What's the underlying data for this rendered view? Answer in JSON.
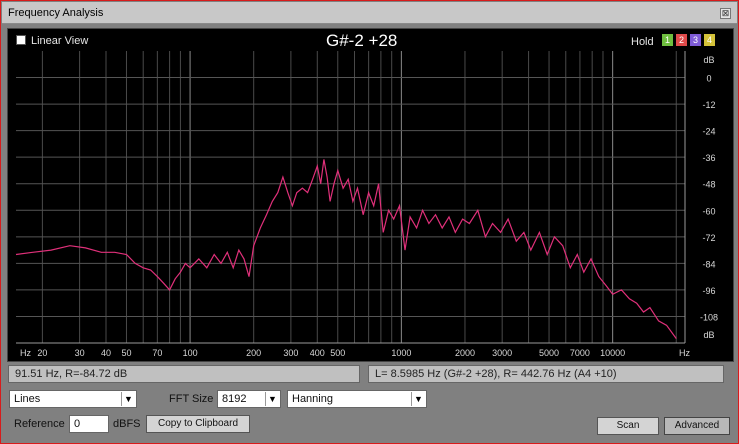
{
  "window": {
    "title": "Frequency Analysis",
    "close_glyph": "⊠"
  },
  "toolbar": {
    "linear_view_label": "Linear View",
    "linear_view_checked": false,
    "note": "G#-2 +28",
    "hold_label": "Hold",
    "hold_buttons": [
      {
        "label": "1",
        "color": "#6fbf3f"
      },
      {
        "label": "2",
        "color": "#e04a4a"
      },
      {
        "label": "3",
        "color": "#7e5bd6"
      },
      {
        "label": "4",
        "color": "#d4c23a"
      }
    ]
  },
  "chart_data": {
    "type": "line",
    "x_scale": "log",
    "xlim": [
      15,
      22000
    ],
    "ylim": [
      -120,
      12
    ],
    "x_unit_label": "Hz",
    "y_unit_label": "dB",
    "x_ticks": [
      {
        "value": 20,
        "label": "20"
      },
      {
        "value": 30,
        "label": "30"
      },
      {
        "value": 40,
        "label": "40"
      },
      {
        "value": 50,
        "label": "50"
      },
      {
        "value": 70,
        "label": "70"
      },
      {
        "value": 100,
        "label": "100"
      },
      {
        "value": 200,
        "label": "200"
      },
      {
        "value": 300,
        "label": "300"
      },
      {
        "value": 400,
        "label": "400"
      },
      {
        "value": 500,
        "label": "500"
      },
      {
        "value": 1000,
        "label": "1000"
      },
      {
        "value": 2000,
        "label": "2000"
      },
      {
        "value": 3000,
        "label": "3000"
      },
      {
        "value": 5000,
        "label": "5000"
      },
      {
        "value": 7000,
        "label": "7000"
      },
      {
        "value": 10000,
        "label": "10000"
      }
    ],
    "y_ticks": [
      {
        "value": 0,
        "label": "0"
      },
      {
        "value": -12,
        "label": "-12"
      },
      {
        "value": -24,
        "label": "-24"
      },
      {
        "value": -36,
        "label": "-36"
      },
      {
        "value": -48,
        "label": "-48"
      },
      {
        "value": -60,
        "label": "-60"
      },
      {
        "value": -72,
        "label": "-72"
      },
      {
        "value": -84,
        "label": "-84"
      },
      {
        "value": -96,
        "label": "-96"
      },
      {
        "value": -108,
        "label": "-108"
      }
    ],
    "series": [
      {
        "color": "#e0307a",
        "points": [
          [
            15,
            -80
          ],
          [
            18,
            -79
          ],
          [
            22,
            -78
          ],
          [
            27,
            -76
          ],
          [
            32,
            -77
          ],
          [
            38,
            -79
          ],
          [
            44,
            -79
          ],
          [
            50,
            -80
          ],
          [
            55,
            -84
          ],
          [
            60,
            -86
          ],
          [
            65,
            -87
          ],
          [
            70,
            -90
          ],
          [
            75,
            -93
          ],
          [
            80,
            -96
          ],
          [
            85,
            -91
          ],
          [
            90,
            -88
          ],
          [
            95,
            -84
          ],
          [
            100,
            -86
          ],
          [
            110,
            -82
          ],
          [
            120,
            -86
          ],
          [
            130,
            -80
          ],
          [
            140,
            -84
          ],
          [
            150,
            -79
          ],
          [
            160,
            -86
          ],
          [
            170,
            -78
          ],
          [
            180,
            -82
          ],
          [
            190,
            -90
          ],
          [
            200,
            -76
          ],
          [
            215,
            -68
          ],
          [
            230,
            -62
          ],
          [
            245,
            -56
          ],
          [
            260,
            -52
          ],
          [
            275,
            -45
          ],
          [
            290,
            -52
          ],
          [
            305,
            -58
          ],
          [
            320,
            -52
          ],
          [
            340,
            -50
          ],
          [
            360,
            -52
          ],
          [
            380,
            -46
          ],
          [
            400,
            -40
          ],
          [
            415,
            -48
          ],
          [
            430,
            -37
          ],
          [
            445,
            -45
          ],
          [
            460,
            -56
          ],
          [
            480,
            -48
          ],
          [
            500,
            -42
          ],
          [
            530,
            -50
          ],
          [
            560,
            -46
          ],
          [
            590,
            -56
          ],
          [
            620,
            -50
          ],
          [
            660,
            -62
          ],
          [
            700,
            -52
          ],
          [
            740,
            -58
          ],
          [
            780,
            -48
          ],
          [
            820,
            -70
          ],
          [
            870,
            -60
          ],
          [
            920,
            -64
          ],
          [
            980,
            -58
          ],
          [
            1040,
            -78
          ],
          [
            1100,
            -63
          ],
          [
            1180,
            -68
          ],
          [
            1260,
            -60
          ],
          [
            1350,
            -66
          ],
          [
            1450,
            -62
          ],
          [
            1560,
            -68
          ],
          [
            1680,
            -63
          ],
          [
            1800,
            -70
          ],
          [
            1950,
            -64
          ],
          [
            2100,
            -66
          ],
          [
            2300,
            -60
          ],
          [
            2500,
            -72
          ],
          [
            2700,
            -66
          ],
          [
            2950,
            -70
          ],
          [
            3200,
            -64
          ],
          [
            3500,
            -74
          ],
          [
            3800,
            -70
          ],
          [
            4100,
            -78
          ],
          [
            4500,
            -70
          ],
          [
            4900,
            -80
          ],
          [
            5300,
            -72
          ],
          [
            5800,
            -76
          ],
          [
            6300,
            -86
          ],
          [
            6800,
            -80
          ],
          [
            7300,
            -88
          ],
          [
            7900,
            -82
          ],
          [
            8600,
            -90
          ],
          [
            9300,
            -94
          ],
          [
            10000,
            -98
          ],
          [
            11000,
            -96
          ],
          [
            12000,
            -100
          ],
          [
            13000,
            -102
          ],
          [
            14000,
            -106
          ],
          [
            15000,
            -104
          ],
          [
            16500,
            -110
          ],
          [
            18000,
            -112
          ],
          [
            20000,
            -118
          ]
        ]
      }
    ]
  },
  "status": {
    "cursor_left": "91.51 Hz, R=-84.72 dB",
    "cursor_right": "L= 8.5985 Hz (G#-2 +28), R= 442.76 Hz (A4 +10)"
  },
  "controls": {
    "display_mode": "Lines",
    "fft_size_label": "FFT Size",
    "fft_size": "8192",
    "window_function": "Hanning",
    "reference_label": "Reference",
    "reference_value": "0",
    "reference_unit": "dBFS",
    "copy_label": "Copy to Clipboard",
    "scan_label": "Scan",
    "advanced_label": "Advanced"
  }
}
